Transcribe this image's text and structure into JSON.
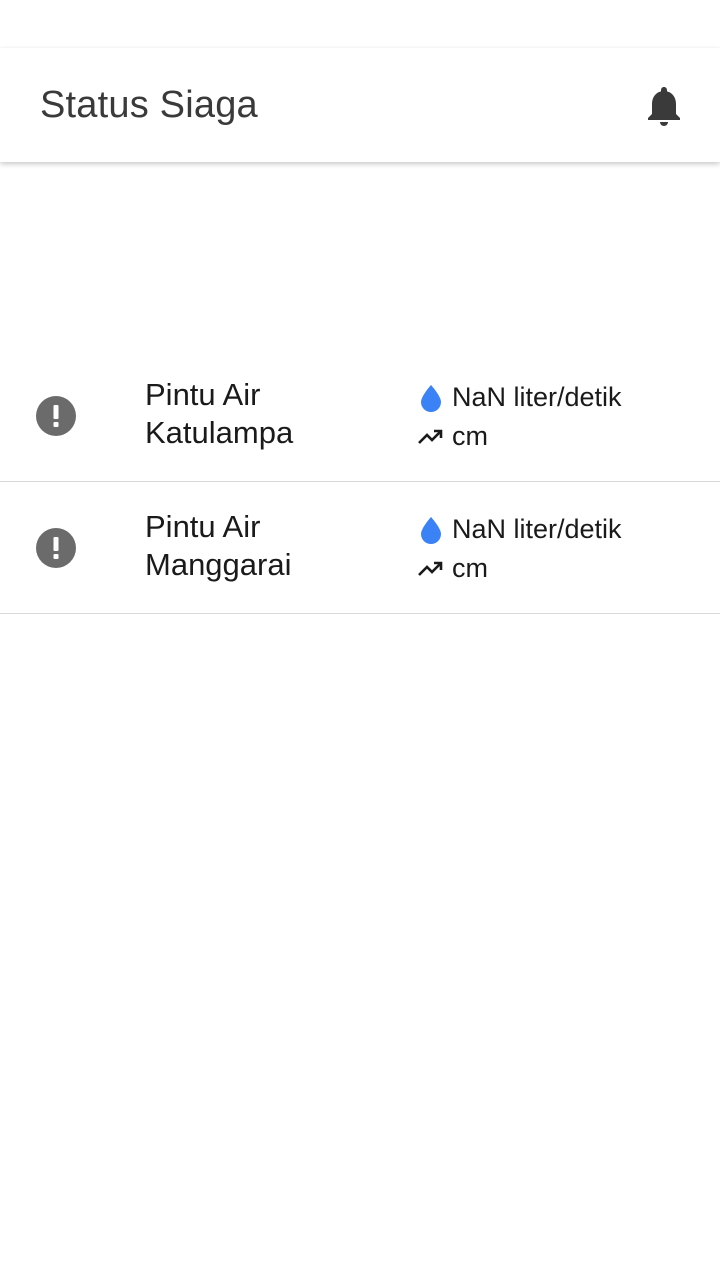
{
  "app_bar": {
    "title": "Status Siaga",
    "notification_icon": "bell-icon"
  },
  "colors": {
    "accent_water": "#3b82f6",
    "alert_icon": "#6b6b6b",
    "title_text": "#3a3a3a"
  },
  "stations": [
    {
      "name": "Pintu Air Katulampa",
      "status_icon": "alert-circle-icon",
      "flow_icon": "water-drop-icon",
      "flow_text": "NaN liter/detik",
      "level_icon": "trending-up-icon",
      "level_text": "cm"
    },
    {
      "name": "Pintu Air Manggarai",
      "status_icon": "alert-circle-icon",
      "flow_icon": "water-drop-icon",
      "flow_text": "NaN liter/detik",
      "level_icon": "trending-up-icon",
      "level_text": "cm"
    }
  ]
}
